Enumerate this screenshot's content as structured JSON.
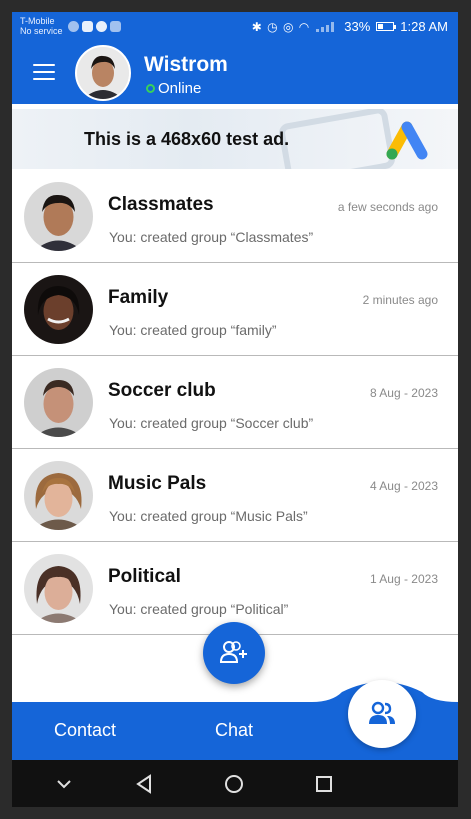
{
  "status_bar": {
    "carrier": "T-Mobile",
    "service": "No service",
    "battery": "33%",
    "battery_level": 0.33,
    "time": "1:28 AM"
  },
  "header": {
    "user_name": "Wistrom",
    "status": "Online",
    "menu_icon": "hamburger-menu-icon",
    "avatar": "user-avatar"
  },
  "ad": {
    "text": "This is a 468x60 test ad.",
    "logo": "google-ads-logo"
  },
  "chats": [
    {
      "name": "Classmates",
      "time": "a few seconds ago",
      "message": "You: created group “Classmates”"
    },
    {
      "name": "Family",
      "time": "2 minutes ago",
      "message": "You: created group “family”"
    },
    {
      "name": "Soccer club",
      "time": "8 Aug - 2023",
      "message": "You: created group “Soccer club”"
    },
    {
      "name": "Music Pals",
      "time": "4 Aug - 2023",
      "message": "You: created group “Music Pals”"
    },
    {
      "name": "Political",
      "time": "1 Aug - 2023",
      "message": "You: created group “Political”"
    }
  ],
  "fab": {
    "icon": "add-group-icon"
  },
  "bottom_nav": {
    "contact_label": "Contact",
    "chat_label": "Chat",
    "groups_icon": "groups-icon"
  },
  "colors": {
    "primary": "#1565d8",
    "online": "#38d15a",
    "background": "#ffffff"
  }
}
